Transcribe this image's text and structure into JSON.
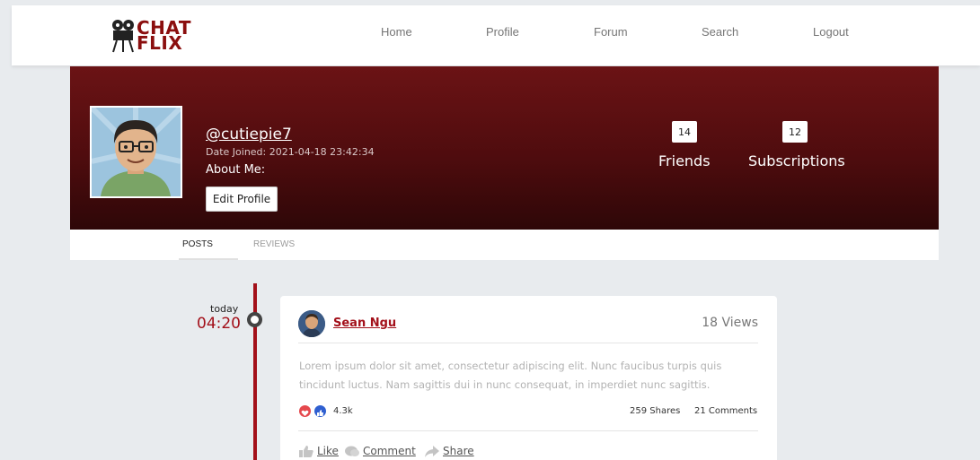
{
  "nav": {
    "logo_line1": "CHAT",
    "logo_line2": "FLIX",
    "items": [
      "Home",
      "Profile",
      "Forum",
      "Search",
      "Logout"
    ]
  },
  "profile": {
    "username": "@cutiepie7",
    "date_joined": "Date Joined: 2021-04-18 23:42:34",
    "about_label": "About Me:",
    "edit_label": "Edit Profile",
    "friends_count": "14",
    "friends_label": "Friends",
    "subscriptions_count": "12",
    "subscriptions_label": "Subscriptions"
  },
  "tabs": {
    "posts": "POSTS",
    "reviews": "REVIEWS"
  },
  "timeline": {
    "day": "today",
    "time": "04:20"
  },
  "post": {
    "author": "Sean Ngu",
    "views": "18 Views",
    "body": "Lorem ipsum dolor sit amet, consectetur adipiscing elit. Nunc faucibus turpis quis tincidunt luctus. Nam sagittis dui in nunc consequat, in imperdiet nunc sagittis.",
    "reaction_count": "4.3k",
    "shares": "259 Shares",
    "comments": "21 Comments",
    "actions": {
      "like": "Like",
      "comment": "Comment",
      "share": "Share"
    }
  },
  "colors": {
    "brand_red": "#a3101a",
    "banner_top": "#6b1315",
    "banner_bottom": "#2e0708",
    "love": "#e5484d",
    "like": "#2f5fd0"
  }
}
